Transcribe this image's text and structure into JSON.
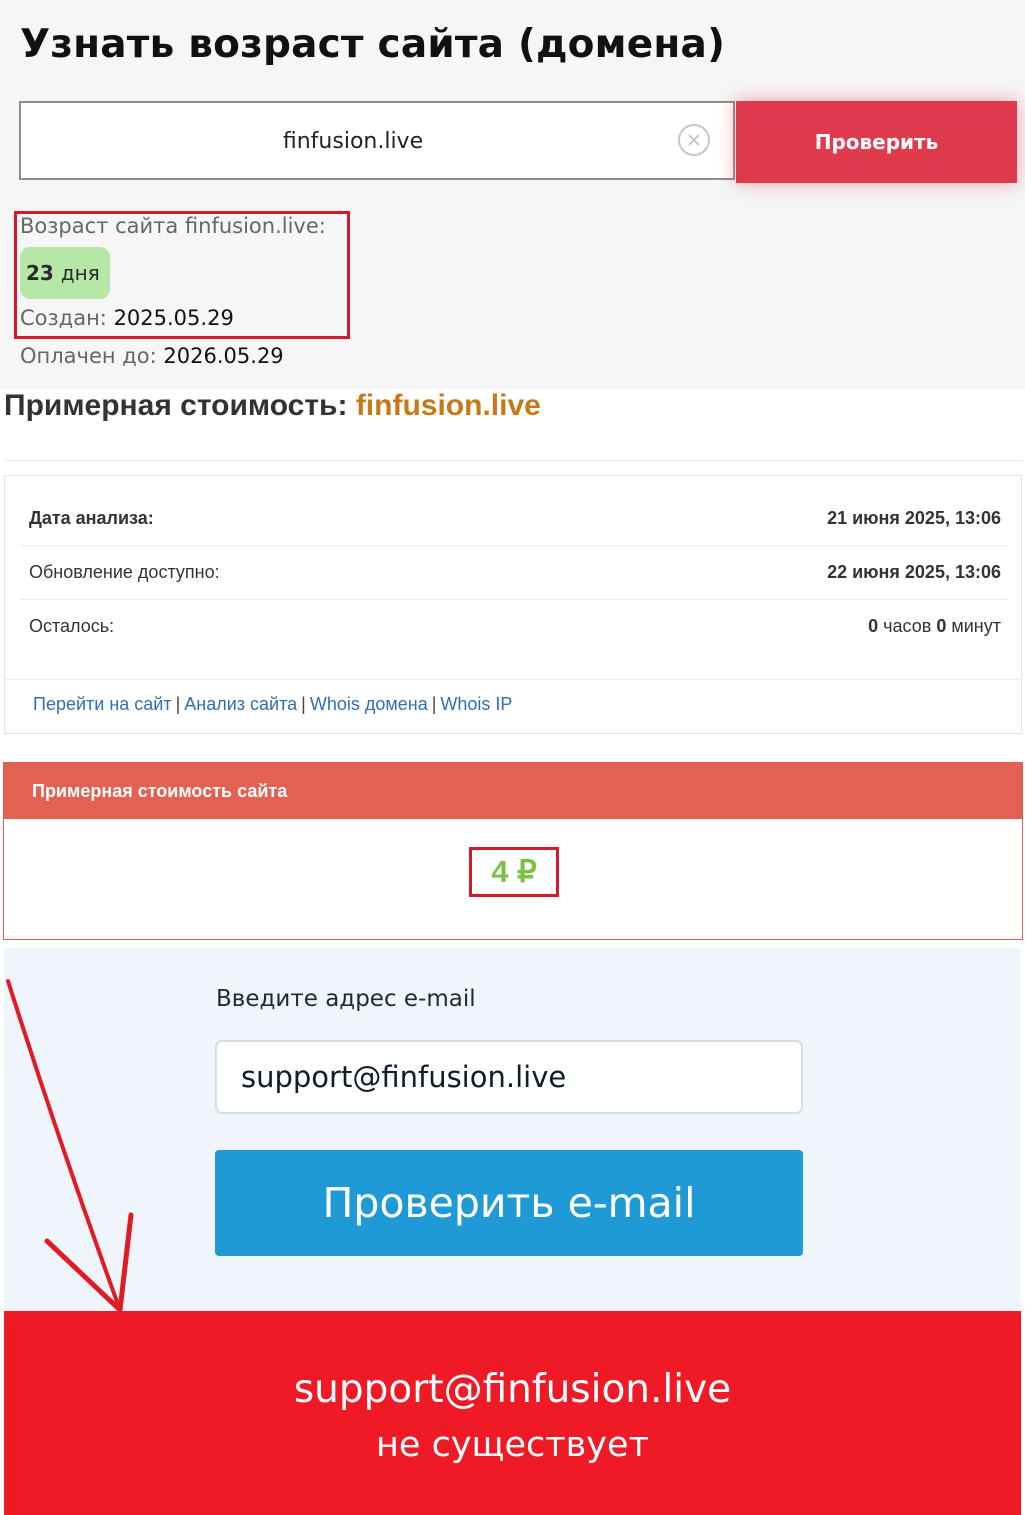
{
  "age_section": {
    "title": "Узнать возраст сайта (домена)",
    "domain_input_value": "finfusion.live",
    "check_button": "Проверить",
    "age_label": "Возраст сайта finfusion.live:",
    "age_number": "23",
    "age_unit": "дня",
    "created_label": "Создан:",
    "created_value": "2025.05.29",
    "paid_label": "Оплачен до:",
    "paid_value": "2026.05.29"
  },
  "cost_section": {
    "title_prefix": "Примерная стоимость:",
    "title_domain": "finfusion.live",
    "rows": [
      {
        "label": "Дата анализа:",
        "value": "21 июня 2025, 13:06"
      },
      {
        "label": "Обновление доступно:",
        "value": "22 июня 2025, 13:06"
      },
      {
        "label": "Осталось:",
        "hours_num": "0",
        "hours_unit": "часов",
        "min_num": "0",
        "min_unit": "минут"
      }
    ],
    "links": [
      "Перейти на сайт",
      "Анализ сайта",
      "Whois домена",
      "Whois IP"
    ],
    "link_separator": "|",
    "card_header": "Примерная стоимость сайта",
    "price": "4 ₽"
  },
  "email_section": {
    "label": "Введите адрес e-mail",
    "input_value": "support@finfusion.live",
    "button": "Проверить e-mail",
    "result_email": "support@finfusion.live",
    "result_message": "не существует"
  },
  "colors": {
    "check_button": "#e03a4d",
    "age_badge": "#b6e7a6",
    "highlight_frame": "#d21a2b",
    "domain_accent": "#c57a17",
    "card_header": "#e36152",
    "price": "#7cc04b",
    "email_button": "#1f9ad6",
    "result_banner": "#ef1a25",
    "arrow": "#e01b24"
  },
  "icons": [
    "clear-icon",
    "arrow-annotation"
  ]
}
